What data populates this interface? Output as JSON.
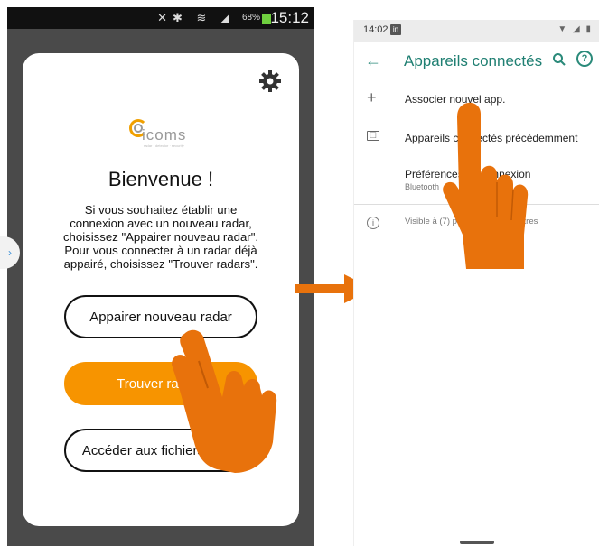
{
  "left_screen": {
    "status": {
      "battery_pct": "68%",
      "clock": "15:12"
    },
    "logo": {
      "word": "icoms",
      "tagline": "radar · detector · security"
    },
    "welcome": {
      "title": "Bienvenue !",
      "lines": [
        "Si vous souhaitez établir une",
        "connexion avec un nouveau radar,",
        "choisissez \"Appairer nouveau radar\".",
        "Pour vous connecter à un radar déjà",
        "appairé, choisissez \"Trouver radars\"."
      ]
    },
    "buttons": {
      "pair": "Appairer nouveau radar",
      "find": "Trouver radars",
      "files": "Accéder aux fichiers radar"
    },
    "accent": "#f79400"
  },
  "right_screen": {
    "status": {
      "time": "14:02",
      "li_badge": "in"
    },
    "appbar": {
      "title": "Appareils connectés"
    },
    "rows": {
      "add": "Associer nouvel app.",
      "previous": "Appareils connectés précédemment",
      "pref_title": "Préférences de connexion",
      "pref_sub": "Bluetooth",
      "info": "Visible à  (7) power\" pour les autres"
    },
    "accent": "#1f7f72"
  },
  "pointer_color": "#e8720c"
}
